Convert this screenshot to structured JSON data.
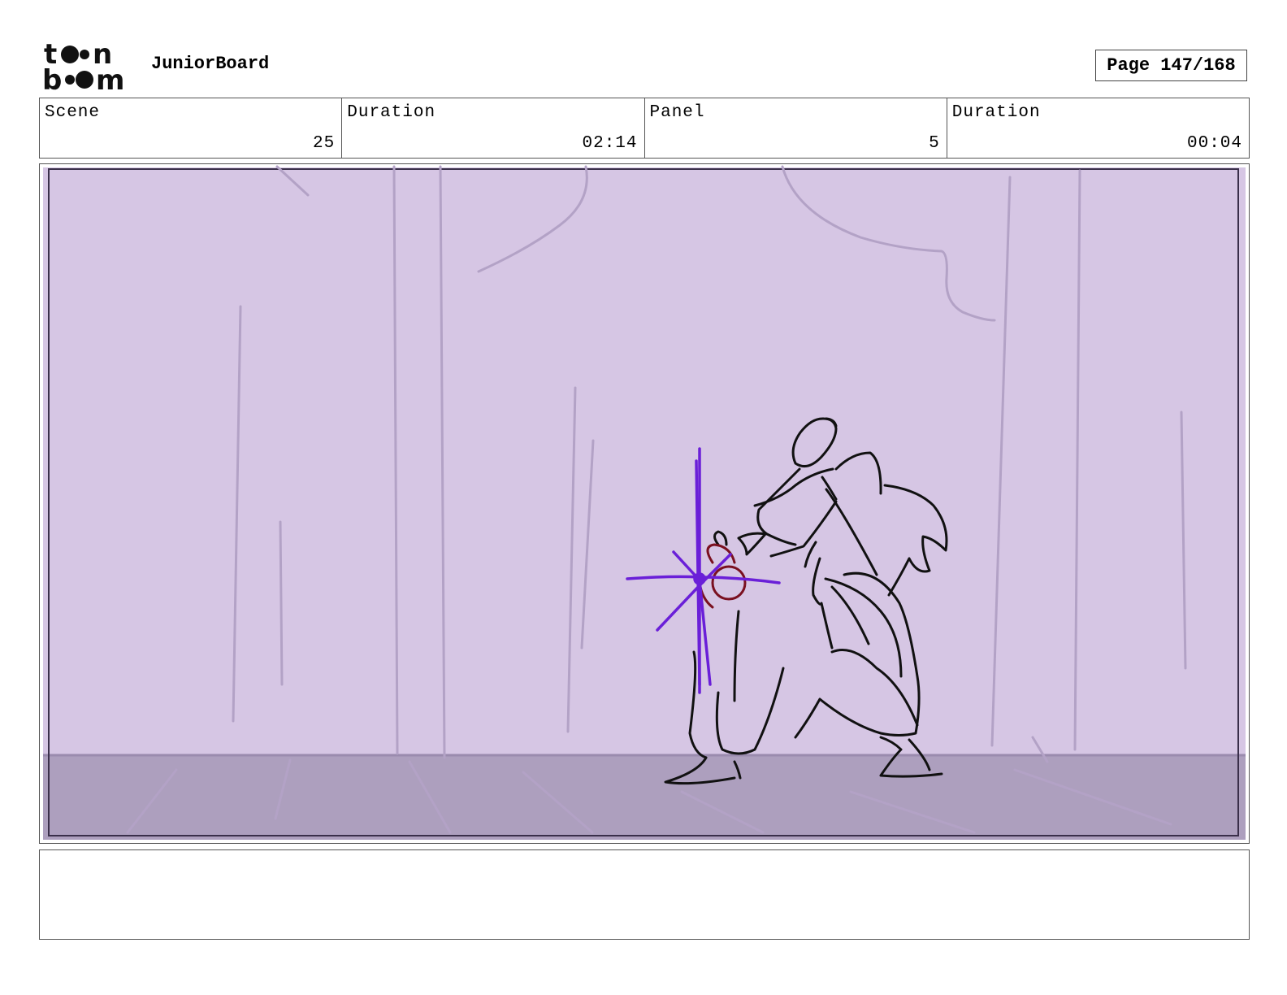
{
  "header": {
    "logo_text": "toon boom",
    "app_name": "JuniorBoard",
    "page_label": "Page 147/168"
  },
  "info": {
    "scene_label": "Scene",
    "scene_value": "25",
    "scene_duration_label": "Duration",
    "scene_duration_value": "02:14",
    "panel_label": "Panel",
    "panel_value": "5",
    "panel_duration_label": "Duration",
    "panel_duration_value": "00:04"
  },
  "notes": {
    "text": ""
  },
  "colors": {
    "sky": "#d6c6e4",
    "floor": "#ad9fbe",
    "sketch_line": "#b7a6c8",
    "character_line": "#111111",
    "spark": "#6a1fd8",
    "hand": "#7a1020"
  }
}
